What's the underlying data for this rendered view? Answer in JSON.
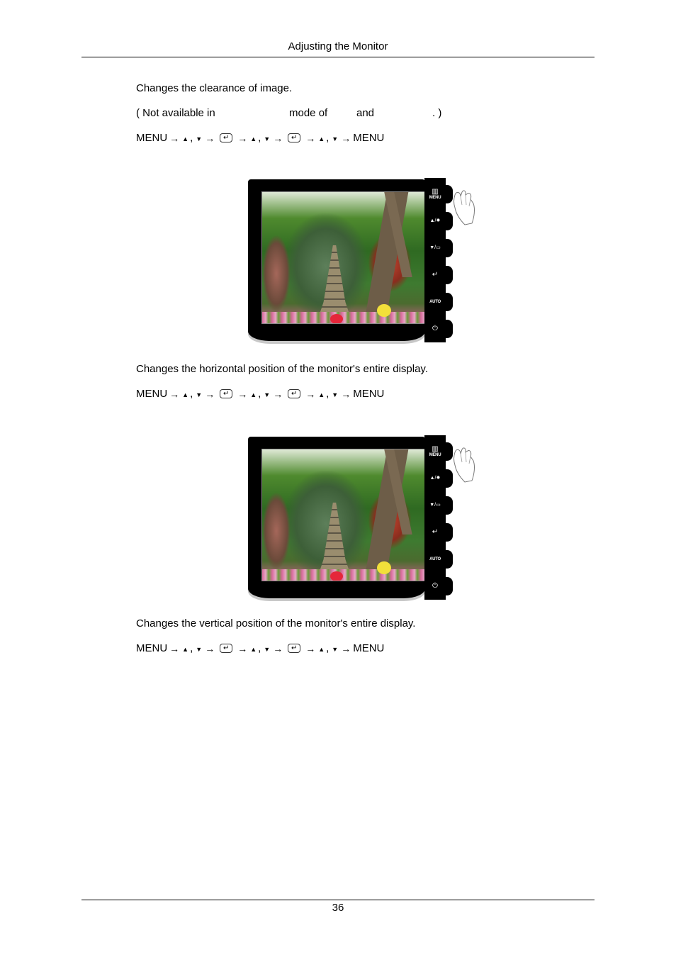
{
  "header": {
    "title": "Adjusting the Monitor"
  },
  "footer": {
    "page_number": "36"
  },
  "sections": [
    {
      "description": "Changes the clearance of image.",
      "note": {
        "part1": "( Not available in",
        "part2": "mode of",
        "part3": "and",
        "part4": ". )"
      },
      "sequence": [
        "MENU",
        "→",
        "▲",
        ",",
        "▼",
        "→",
        "enter-key",
        "→",
        "▲",
        ",",
        "▼",
        "→",
        "enter-key",
        "→",
        "▲",
        ",",
        "▼",
        "→",
        "MENU"
      ]
    },
    {
      "description": "Changes the horizontal position of the monitor's entire display.",
      "sequence": [
        "MENU",
        "→",
        "▲",
        ",",
        "▼",
        "→",
        "enter-key",
        "→",
        "▲",
        ",",
        "▼",
        "→",
        "enter-key",
        "→",
        "▲",
        ",",
        "▼",
        "→",
        "MENU"
      ]
    },
    {
      "description": "Changes the vertical position of the monitor's entire display.",
      "sequence": [
        "MENU",
        "→",
        "▲",
        ",",
        "▼",
        "→",
        "enter-key",
        "→",
        "▲",
        ",",
        "▼",
        "→",
        "enter-key",
        "→",
        "▲",
        ",",
        "▼",
        "→",
        "MENU"
      ]
    }
  ],
  "monitor_panel": {
    "buttons": [
      {
        "icon": "menu-icon",
        "glyph": "▥",
        "label": "MENU"
      },
      {
        "icon": "up-brightness-icon",
        "glyph": "▲/✹",
        "label": ""
      },
      {
        "icon": "down-source-icon",
        "glyph": "▼/▭",
        "label": ""
      },
      {
        "icon": "enter-icon",
        "glyph": "↵",
        "label": ""
      },
      {
        "icon": "auto-icon",
        "glyph": "",
        "label": "AUTO"
      },
      {
        "icon": "power-icon",
        "glyph": "⏻",
        "label": ""
      }
    ]
  },
  "symbols": {
    "arrow": "→",
    "up": "▲",
    "down": "▼",
    "comma": ",",
    "enter": "↵"
  }
}
